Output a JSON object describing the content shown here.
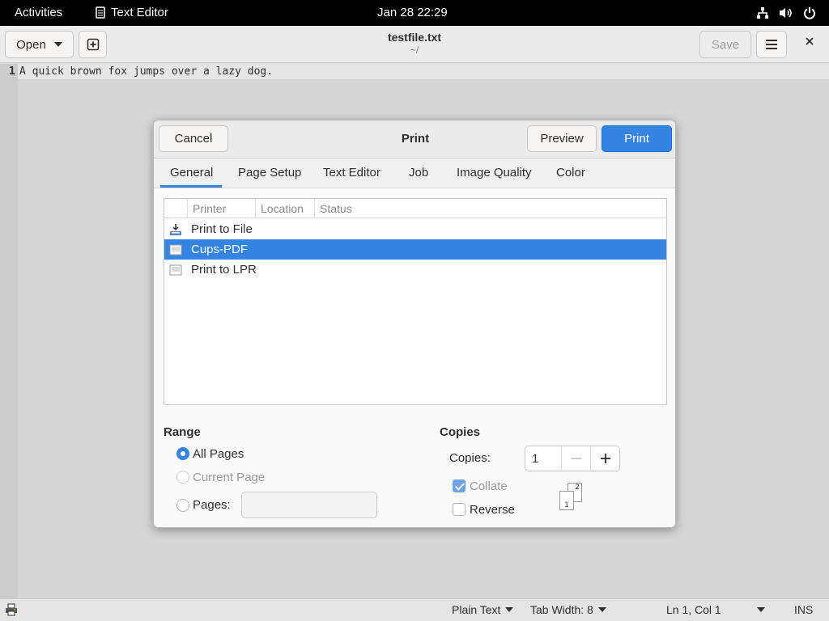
{
  "topbar": {
    "activities": "Activities",
    "app_name": "Text Editor",
    "clock": "Jan 28  22:29",
    "tray_icons": [
      "network-icon",
      "volume-icon",
      "power-icon"
    ]
  },
  "header": {
    "open_label": "Open",
    "title": "testfile.txt",
    "subtitle": "~/",
    "save_label": "Save"
  },
  "editor": {
    "line_number": "1",
    "line_text": "A quick brown fox jumps over a lazy dog."
  },
  "statusbar": {
    "language": "Plain Text",
    "tab_width": "Tab Width: 8",
    "position": "Ln 1, Col 1",
    "mode": "INS"
  },
  "dialog": {
    "title": "Print",
    "cancel_label": "Cancel",
    "preview_label": "Preview",
    "print_label": "Print",
    "tabs": [
      "General",
      "Page Setup",
      "Text Editor",
      "Job",
      "Image Quality",
      "Color"
    ],
    "active_tab": "General",
    "columns": [
      "Printer",
      "Location",
      "Status"
    ],
    "printers": [
      {
        "name": "Print to File",
        "icon": "print-to-file-icon",
        "selected": false
      },
      {
        "name": "Cups-PDF",
        "icon": "printer-icon",
        "selected": true
      },
      {
        "name": "Print to LPR",
        "icon": "printer-icon",
        "selected": false
      }
    ],
    "range": {
      "title": "Range",
      "all_pages": "All Pages",
      "current_page": "Current Page",
      "pages": "Pages:",
      "pages_value": ""
    },
    "copies": {
      "title": "Copies",
      "copies_label": "Copies:",
      "copies_value": "1",
      "collate": "Collate",
      "reverse": "Reverse",
      "collate_sheet_1": "1",
      "collate_sheet_2": "2"
    }
  },
  "colors": {
    "accent": "#3584e4",
    "topbar": "#000000"
  }
}
